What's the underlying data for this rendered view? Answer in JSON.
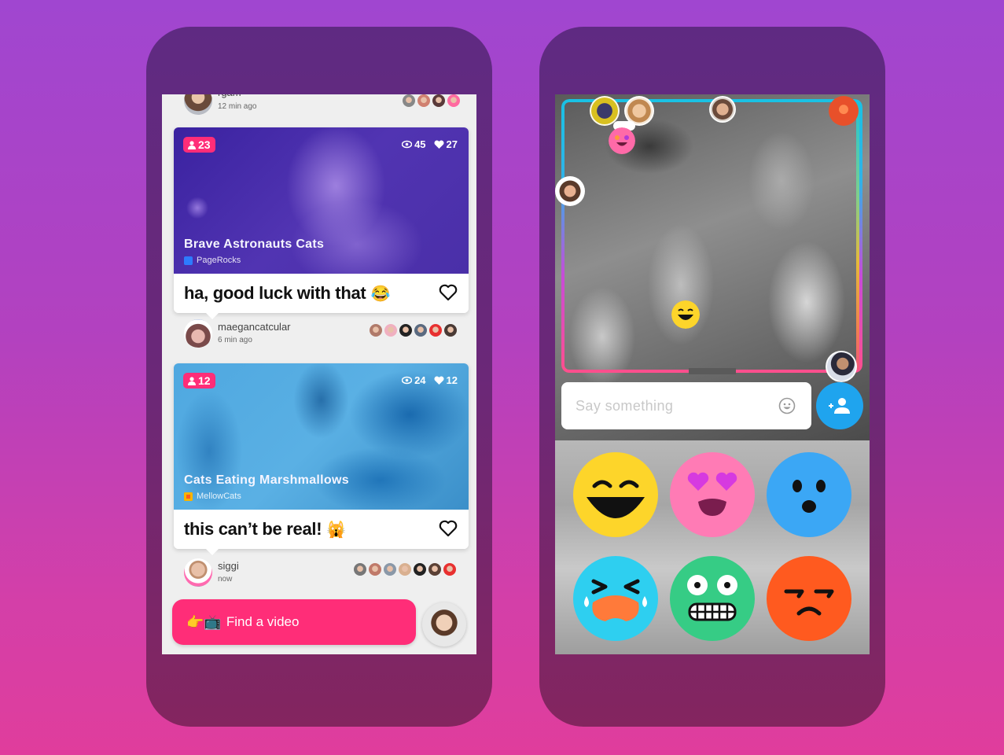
{
  "left_phone": {
    "previous_post": {
      "user": "rgam",
      "time": "12 min ago",
      "reactor_colors": [
        "#888888",
        "#d08070",
        "#5a3a3a",
        "#ff6aa0"
      ]
    },
    "cards": [
      {
        "viewers": "23",
        "views": "45",
        "likes": "27",
        "title": "Brave Astronauts Cats",
        "channel": "PageRocks",
        "channel_color": "#2d7bff",
        "caption": "ha, good luck with that",
        "caption_emoji": "😂",
        "user": "maegancatcular",
        "time": "6 min ago",
        "reactor_colors": [
          "#b07a6a",
          "#f0b0c0",
          "#222222",
          "#5a6a80",
          "#e83030",
          "#4a3a35"
        ]
      },
      {
        "viewers": "12",
        "views": "24",
        "likes": "12",
        "title": "Cats Eating Marshmallows",
        "channel": "MellowCats",
        "channel_color": "#f7b500",
        "caption": "this can’t be real!",
        "caption_emoji": "🙀",
        "user": "siggi",
        "time": "now",
        "reactor_colors": [
          "#777777",
          "#c07a6a",
          "#8a98a8",
          "#d9b090",
          "#222222",
          "#5a4035",
          "#e83030"
        ]
      }
    ],
    "find_button": {
      "emoji": "👉📺",
      "label": "Find a video"
    }
  },
  "right_phone": {
    "chat": {
      "placeholder": "Say something"
    },
    "reactions": [
      {
        "name": "laughing",
        "color": "#fdd52a"
      },
      {
        "name": "heart-eyes",
        "color": "#ff7bb5"
      },
      {
        "name": "surprised",
        "color": "#3ba7f5"
      },
      {
        "name": "crying",
        "color": "#2ecff0"
      },
      {
        "name": "grimacing",
        "color": "#36cc85"
      },
      {
        "name": "angry",
        "color": "#ff5a1f"
      }
    ],
    "colors": {
      "add_friend_button": "#1fa4ee"
    }
  },
  "colors": {
    "accent_pink": "#ff2d78"
  }
}
